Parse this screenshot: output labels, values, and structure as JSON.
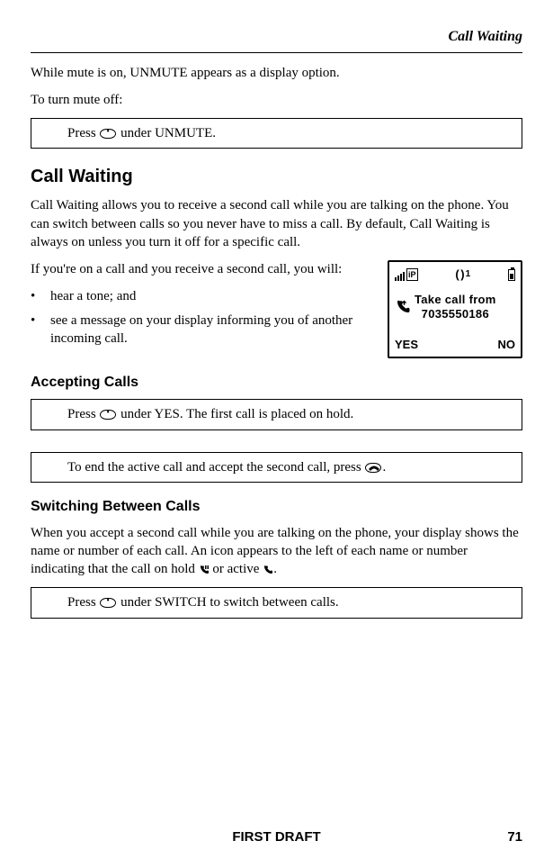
{
  "running_head": "Call Waiting",
  "intro_line1": "While mute is on, UNMUTE appears as a display option.",
  "intro_line2": "To turn mute off:",
  "box1_pre": "Press ",
  "box1_post": " under UNMUTE.",
  "h2": "Call Waiting",
  "cw_para": "Call Waiting allows you to receive a second call while you are talking on the phone. You can switch between calls so you never have to miss a call. By default, Call Waiting is always on unless you turn it off for a specific call.",
  "cw_lead": "If you're on a call and you receive a second call, you will:",
  "bullet1": "hear a tone; and",
  "bullet2": "see a message on your display informing you of another incoming call.",
  "screen": {
    "line1": "Take call from",
    "line2": "7035550186",
    "yes": "YES",
    "no": "NO"
  },
  "h3a": "Accepting Calls",
  "box2_pre": "Press ",
  "box2_post": " under YES. The first call is placed on hold.",
  "box3_pre": "To end the active call and accept the second call, press ",
  "box3_post": ".",
  "h3b": "Switching Between Calls",
  "switch_para_1": "When you accept a second call while you are talking on the phone, your display shows the name or number of each call. An icon appears to the left of each name or number indicating that the call on hold ",
  "switch_para_2": " or active ",
  "switch_para_3": ".",
  "box4_pre": "Press ",
  "box4_post": " under SWITCH to switch between calls.",
  "footer_text": "FIRST DRAFT",
  "page_num": "71"
}
